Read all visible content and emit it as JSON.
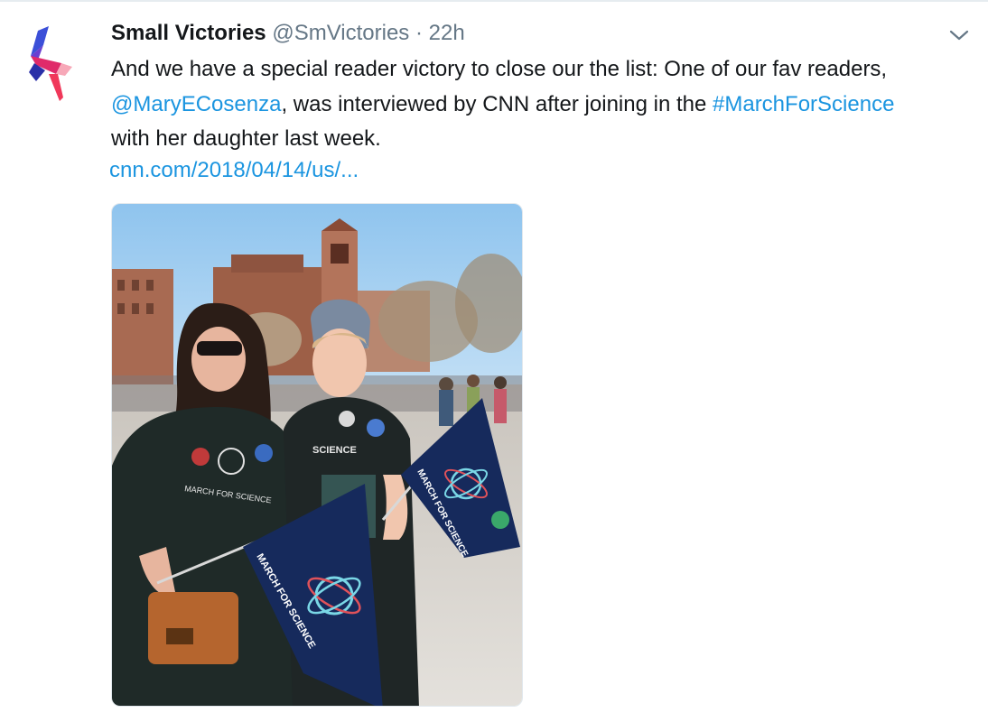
{
  "tweet": {
    "display_name": "Small Victories",
    "handle": "@SmVictories",
    "separator": "·",
    "time": "22h",
    "text_line1": "And we have a special reader victory to close our the list: One of our fav readers,",
    "mention": "@MaryECosenza",
    "text_line2_mid": ", was interviewed by CNN after joining in the ",
    "hashtag": "#MarchForScience",
    "text_line3": "with her daughter last week.",
    "url": "cnn.com/2018/04/14/us/..."
  },
  "photo": {
    "flag_text": "MARCH FOR SCIENCE",
    "shirt_text_left": "MARCH FOR SCIENCE",
    "shirt_text_right": "SCIENCE"
  },
  "icons": {
    "avatar": "small-victories-logo-icon",
    "menu": "chevron-down-icon"
  },
  "colors": {
    "link": "#1b95e0",
    "muted": "#657786",
    "logo_blue": "#3b4fd8",
    "logo_red": "#f0385a"
  }
}
